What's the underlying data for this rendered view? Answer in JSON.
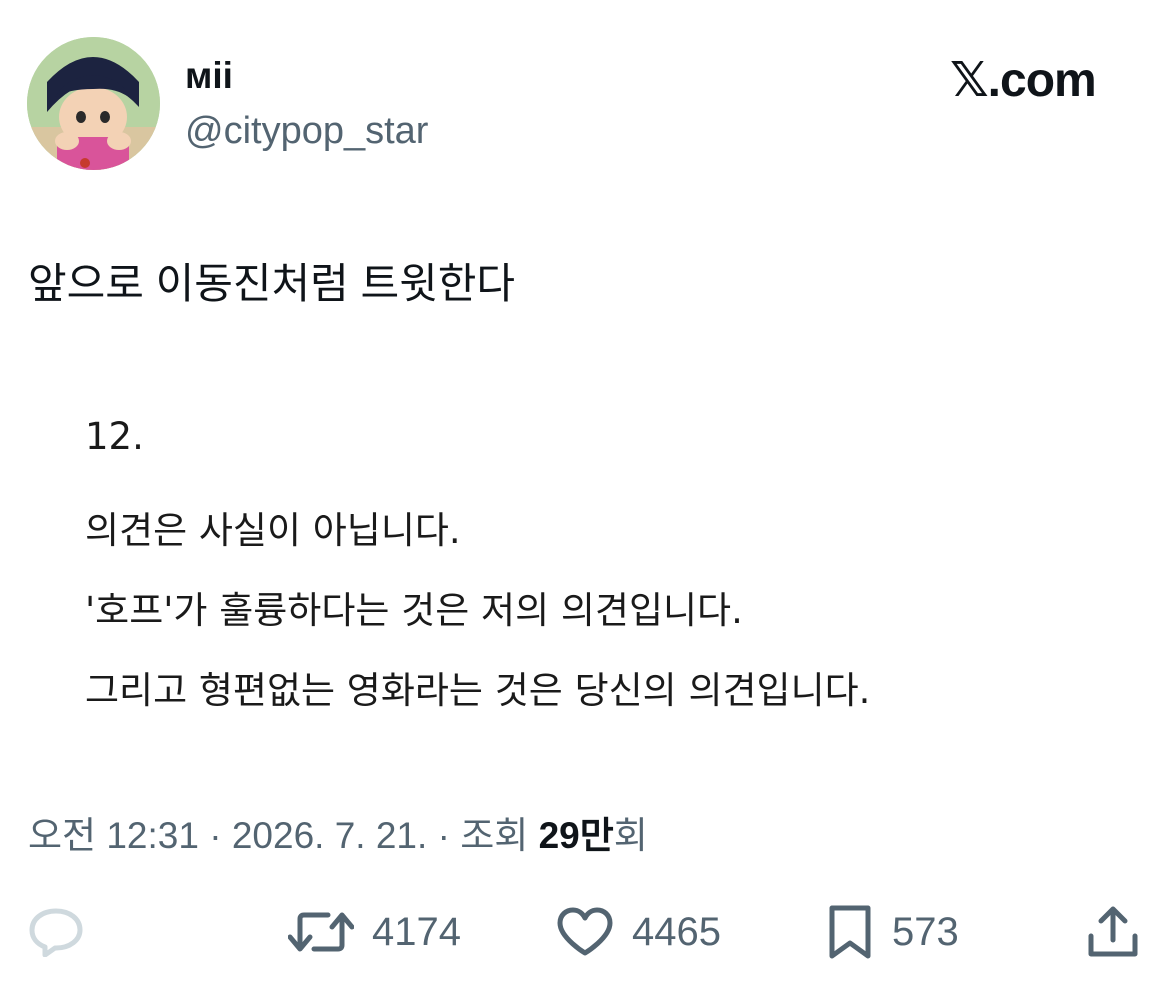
{
  "author": {
    "display_name": "ᴍii",
    "handle": "@citypop_star"
  },
  "brand": {
    "mark": "𝕏",
    "domain": ".com"
  },
  "tweet": {
    "text": "앞으로 이동진처럼 트윗한다"
  },
  "quoted_image": {
    "lines": [
      "12.",
      "의견은 사실이 아닙니다.",
      "'호프'가 훌륭하다는 것은 저의 의견입니다.",
      "그리고 형편없는 영화라는 것은 당신의 의견입니다."
    ]
  },
  "meta": {
    "time": "오전 12:31",
    "separator": "·",
    "date": "2026. 7. 21.",
    "views_prefix": "조회",
    "views_count": "29만",
    "views_suffix": "회"
  },
  "actions": {
    "reply": {
      "icon": "reply-icon",
      "count": ""
    },
    "retweet": {
      "icon": "retweet-icon",
      "count": "4174"
    },
    "like": {
      "icon": "heart-icon",
      "count": "4465"
    },
    "bookmark": {
      "icon": "bookmark-icon",
      "count": "573"
    },
    "share": {
      "icon": "share-icon"
    }
  },
  "colors": {
    "text_primary": "#0f1419",
    "text_secondary": "#536471",
    "reply_icon": "#cfd9de"
  }
}
